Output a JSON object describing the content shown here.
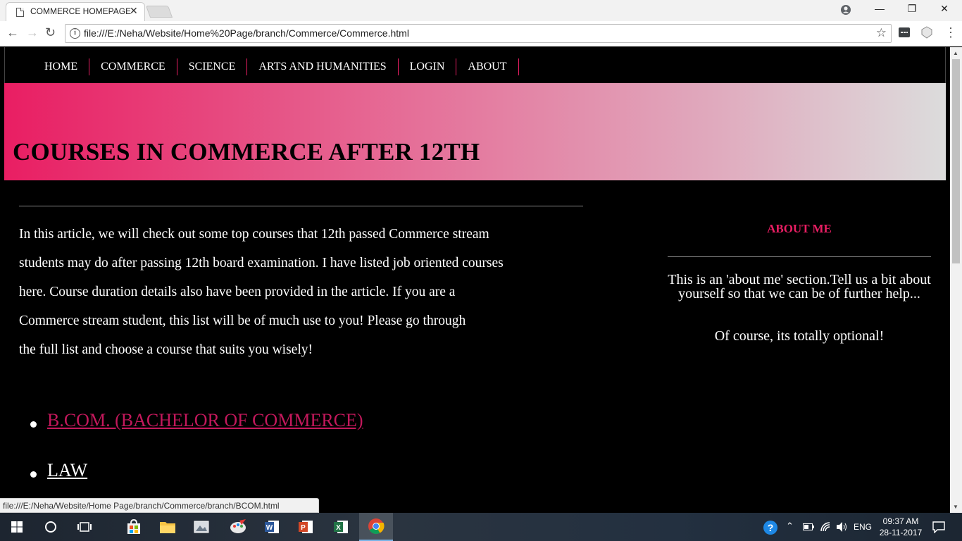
{
  "browser": {
    "tab_title": "COMMERCE HOMEPAGE",
    "tab_close": "✕",
    "url": "file:///E:/Neha/Website/Home%20Page/branch/Commerce/Commerce.html",
    "status_url": "file:///E:/Neha/Website/Home Page/branch/Commerce/branch/BCOM.html",
    "window_buttons": {
      "minimize": "—",
      "restore": "❐",
      "close": "✕"
    }
  },
  "nav": {
    "items": [
      "HOME",
      "COMMERCE",
      "SCIENCE",
      "ARTS AND HUMANITIES",
      "LOGIN",
      "ABOUT"
    ],
    "accent": "#e91e63"
  },
  "banner": {
    "title": "COURSES IN COMMERCE AFTER 12TH"
  },
  "article": {
    "lines": [
      "In this article, we will check out some top courses that 12th passed Commerce stream",
      "students may do after passing 12th board examination. I have listed job oriented courses",
      "here. Course duration details also have been provided in the article. If you are a",
      "Commerce stream student, this list will be of much use to you! Please go through",
      "the full list and choose a course that suits you wisely!"
    ]
  },
  "courses": [
    {
      "label": "B.COM. (BACHELOR OF COMMERCE)",
      "color": "#c2185b"
    },
    {
      "label": "LAW",
      "color": "#ffffff"
    }
  ],
  "sidebar": {
    "title": "ABOUT ME",
    "text": "This is an 'about me' section.Tell us a bit about yourself so that we can be of further help...",
    "note": "Of course, its totally optional!"
  },
  "taskbar": {
    "lang": "ENG",
    "time": "09:37 AM",
    "date": "28-11-2017"
  }
}
